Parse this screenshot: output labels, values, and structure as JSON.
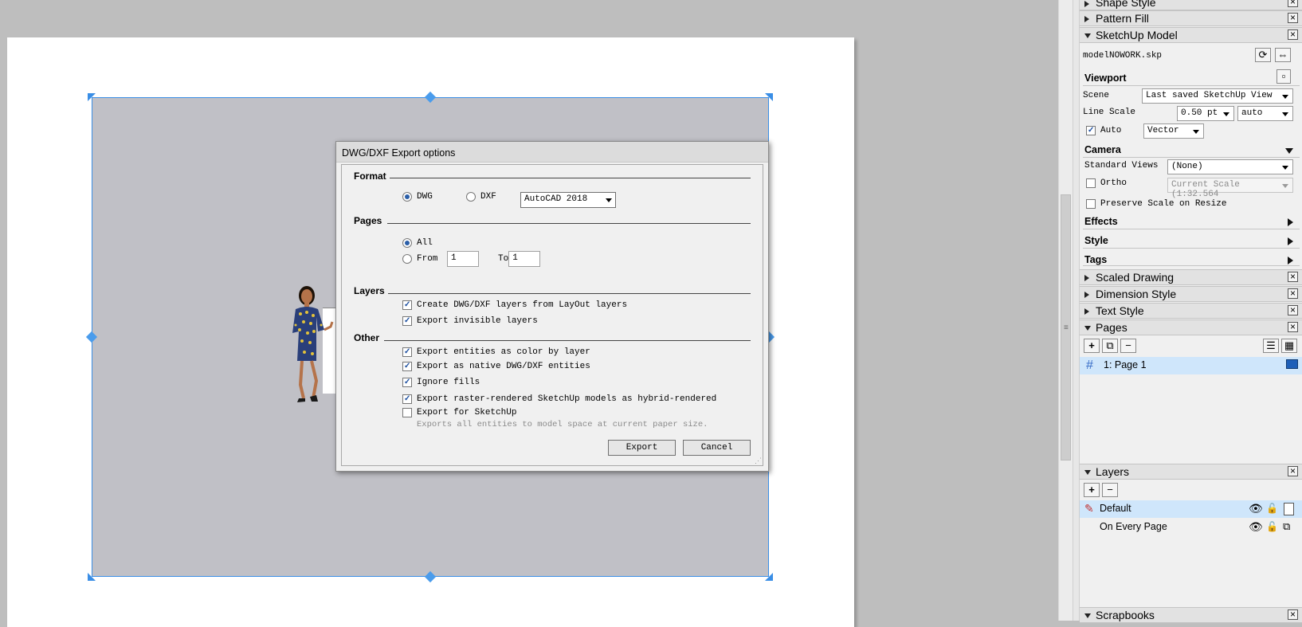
{
  "dialog": {
    "title": "DWG/DXF Export options",
    "format": {
      "heading": "Format",
      "dwg_label": "DWG",
      "dxf_label": "DXF",
      "version_value": "AutoCAD 2018"
    },
    "pages": {
      "heading": "Pages",
      "all_label": "All",
      "from_label": "From",
      "from_value": "1",
      "to_label": "To",
      "to_value": "1"
    },
    "layers": {
      "heading": "Layers",
      "create_layers_label": "Create DWG/DXF layers from LayOut layers",
      "export_invisible_label": "Export invisible layers"
    },
    "other": {
      "heading": "Other",
      "color_by_layer_label": "Export entities as color by layer",
      "native_entities_label": "Export as native DWG/DXF entities",
      "ignore_fills_label": "Ignore fills",
      "hybrid_label": "Export raster-rendered SketchUp models as hybrid-rendered",
      "for_sketchup_label": "Export for SketchUp",
      "for_sketchup_hint": "Exports all entities to model space at current paper size."
    },
    "export_button": "Export",
    "cancel_button": "Cancel"
  },
  "panel": {
    "shape_style": "Shape Style",
    "pattern_fill": "Pattern Fill",
    "sketchup_model": "SketchUp Model",
    "model_file": "modelNOWORK.skp",
    "viewport_heading": "Viewport",
    "scene_label": "Scene",
    "scene_value": "Last saved SketchUp View",
    "line_scale_label": "Line Scale",
    "line_scale_value": "0.50 pt",
    "line_scale_mode": "auto",
    "auto_label": "Auto",
    "render_value": "Vector",
    "camera_heading": "Camera",
    "standard_views_label": "Standard Views",
    "standard_views_value": "(None)",
    "ortho_label": "Ortho",
    "ortho_value": "Current Scale (1:32.564",
    "preserve_scale_label": "Preserve Scale on Resize",
    "effects_heading": "Effects",
    "style_heading": "Style",
    "tags_heading": "Tags",
    "scaled_drawing": "Scaled Drawing",
    "dimension_style": "Dimension Style",
    "text_style": "Text Style",
    "pages": "Pages",
    "page_item": "1:  Page 1",
    "layers": "Layers",
    "layer_default": "Default",
    "layer_every_page": "On Every Page",
    "scrapbooks": "Scrapbooks",
    "icons": {
      "add": "+",
      "remove": "−",
      "close": "×"
    }
  }
}
